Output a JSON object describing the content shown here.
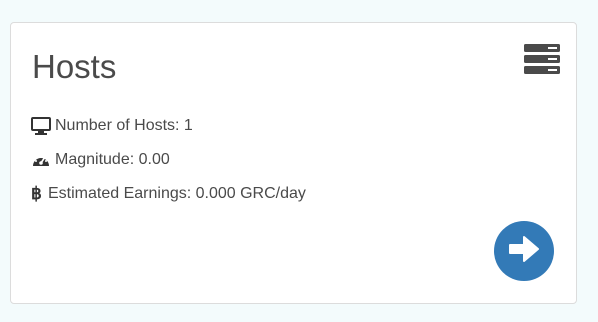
{
  "card": {
    "title": "Hosts",
    "icon": "server-icon",
    "stats": [
      {
        "icon": "desktop-icon",
        "label": "Number of Hosts: 1"
      },
      {
        "icon": "tachometer-icon",
        "label": "Magnitude: 0.00"
      },
      {
        "icon": "bitcoin-icon",
        "label": "Estimated Earnings: 0.000 GRC/day"
      }
    ],
    "action": {
      "icon": "arrow-right-circle-icon"
    }
  },
  "colors": {
    "background": "#f3fbfc",
    "card": "#ffffff",
    "text": "#4a4a4a",
    "accent": "#337ab7"
  }
}
